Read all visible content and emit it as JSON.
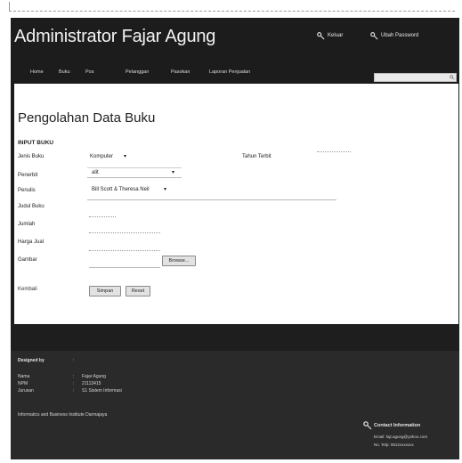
{
  "header": {
    "title": "Administrator Fajar Agung",
    "links": [
      {
        "label": "Keluar",
        "icon": "key-icon"
      },
      {
        "label": "Ubah Password",
        "icon": "key-icon"
      }
    ]
  },
  "nav": {
    "items": [
      "Home",
      "Buku",
      "Pos",
      "Pelanggan",
      "Pasokan",
      "Laporan Penjualan"
    ],
    "search_placeholder": ""
  },
  "main": {
    "page_title": "Pengolahan Data Buku",
    "section_title": "INPUT BUKU",
    "fields": {
      "jenis_buku": {
        "label": "Jenis Buku",
        "value": "Komputer"
      },
      "tahun_terbit": {
        "label": "Tahun Terbit",
        "value": ""
      },
      "penerbit": {
        "label": "Penerbit",
        "value": "alit"
      },
      "penulis": {
        "label": "Penulis",
        "value": "Bill Scott & Theresa Neil"
      },
      "judul_buku": {
        "label": "Judul Buku",
        "value": ""
      },
      "jumlah": {
        "label": "Jumlah",
        "value": ""
      },
      "harga_jual": {
        "label": "Harga Jual",
        "value": ""
      },
      "gambar": {
        "label": "Gambar",
        "value": ""
      }
    },
    "browse_label": "Browse...",
    "kembali_label": "Kembali",
    "simpan_label": "Simpan",
    "reset_label": "Reset"
  },
  "footer": {
    "designed_by_label": "Designed by",
    "designed_by_sep": ":",
    "rows": [
      {
        "key": "Nama",
        "sep": ":",
        "value": "Fajar Agung"
      },
      {
        "key": "NPM",
        "sep": ":",
        "value": "21113415"
      },
      {
        "key": "Jurusan",
        "sep": ":",
        "value": "S1 Sistem Informasi"
      }
    ],
    "institution": "Informatics and Business Institute Darmajaya",
    "contact": {
      "title": "Contact Information",
      "email": "Email: fajr.agung@yahoo.com",
      "phone": "No. Telp: 0812xxxxxxx"
    }
  },
  "colors": {
    "frame_bg": "#1c1c1c",
    "panel_bg": "#ffffff",
    "footer_bg": "#2a2a2a",
    "text_light": "#e8e8e8"
  }
}
